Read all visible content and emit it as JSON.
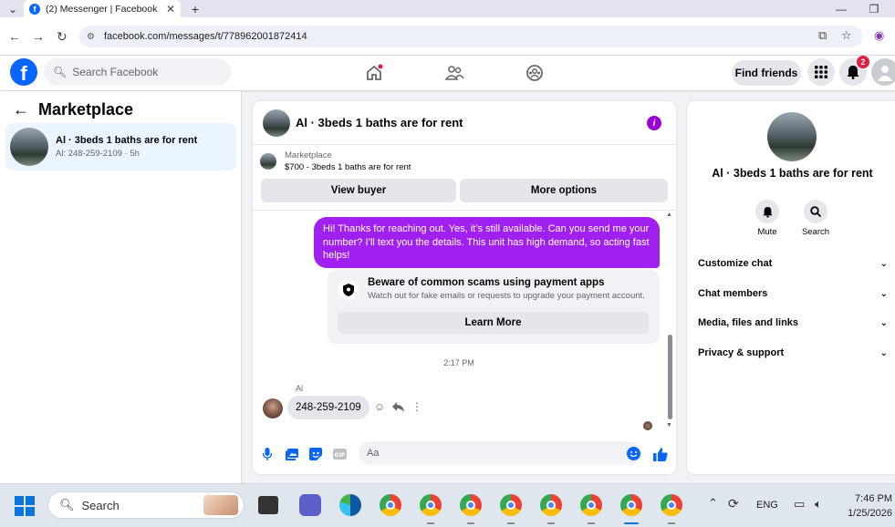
{
  "browser": {
    "tab_title": "(2) Messenger | Facebook",
    "tab_close": "✕",
    "new_tab": "+",
    "url": "facebook.com/messages/t/778962001872414"
  },
  "fb_header": {
    "logo_letter": "f",
    "search_placeholder": "Search Facebook",
    "find_friends": "Find friends",
    "notification_count": "2"
  },
  "left_panel": {
    "title": "Marketplace",
    "conversation": {
      "title": "Al · 3beds 1 baths are for rent",
      "subtitle": "Al: 248-259-2109 · 5h"
    }
  },
  "chat": {
    "header_title": "Al · 3beds 1 baths are for rent",
    "listing_label": "Marketplace",
    "listing_price": "$700 - 3beds 1 baths are for rent",
    "view_buyer": "View buyer",
    "more_options": "More options",
    "outgoing_message": "Hi! Thanks for reaching out. Yes, it’s still available. Can you send me your number? I’ll text you the details. This unit has high demand, so acting fast helps!",
    "scam_title": "Beware of common scams using payment apps",
    "scam_desc": "Watch out for fake emails or requests to upgrade your payment account.",
    "learn_more": "Learn More",
    "timestamp": "2:17 PM",
    "sender_name": "Al",
    "incoming_message": "248-259-2109",
    "input_placeholder": "Aa"
  },
  "right_panel": {
    "name": "Al · 3beds 1 baths are for rent",
    "mute_label": "Mute",
    "search_label": "Search",
    "rows": [
      "Customize chat",
      "Chat members",
      "Media, files and links",
      "Privacy & support"
    ]
  },
  "taskbar": {
    "search_placeholder": "Search",
    "language": "ENG",
    "time": "7:46 PM",
    "date": "1/25/2026"
  },
  "colors": {
    "fb_blue": "#0866ff",
    "messenger_purple": "#a020f0",
    "notification_red": "#e41e3f"
  }
}
